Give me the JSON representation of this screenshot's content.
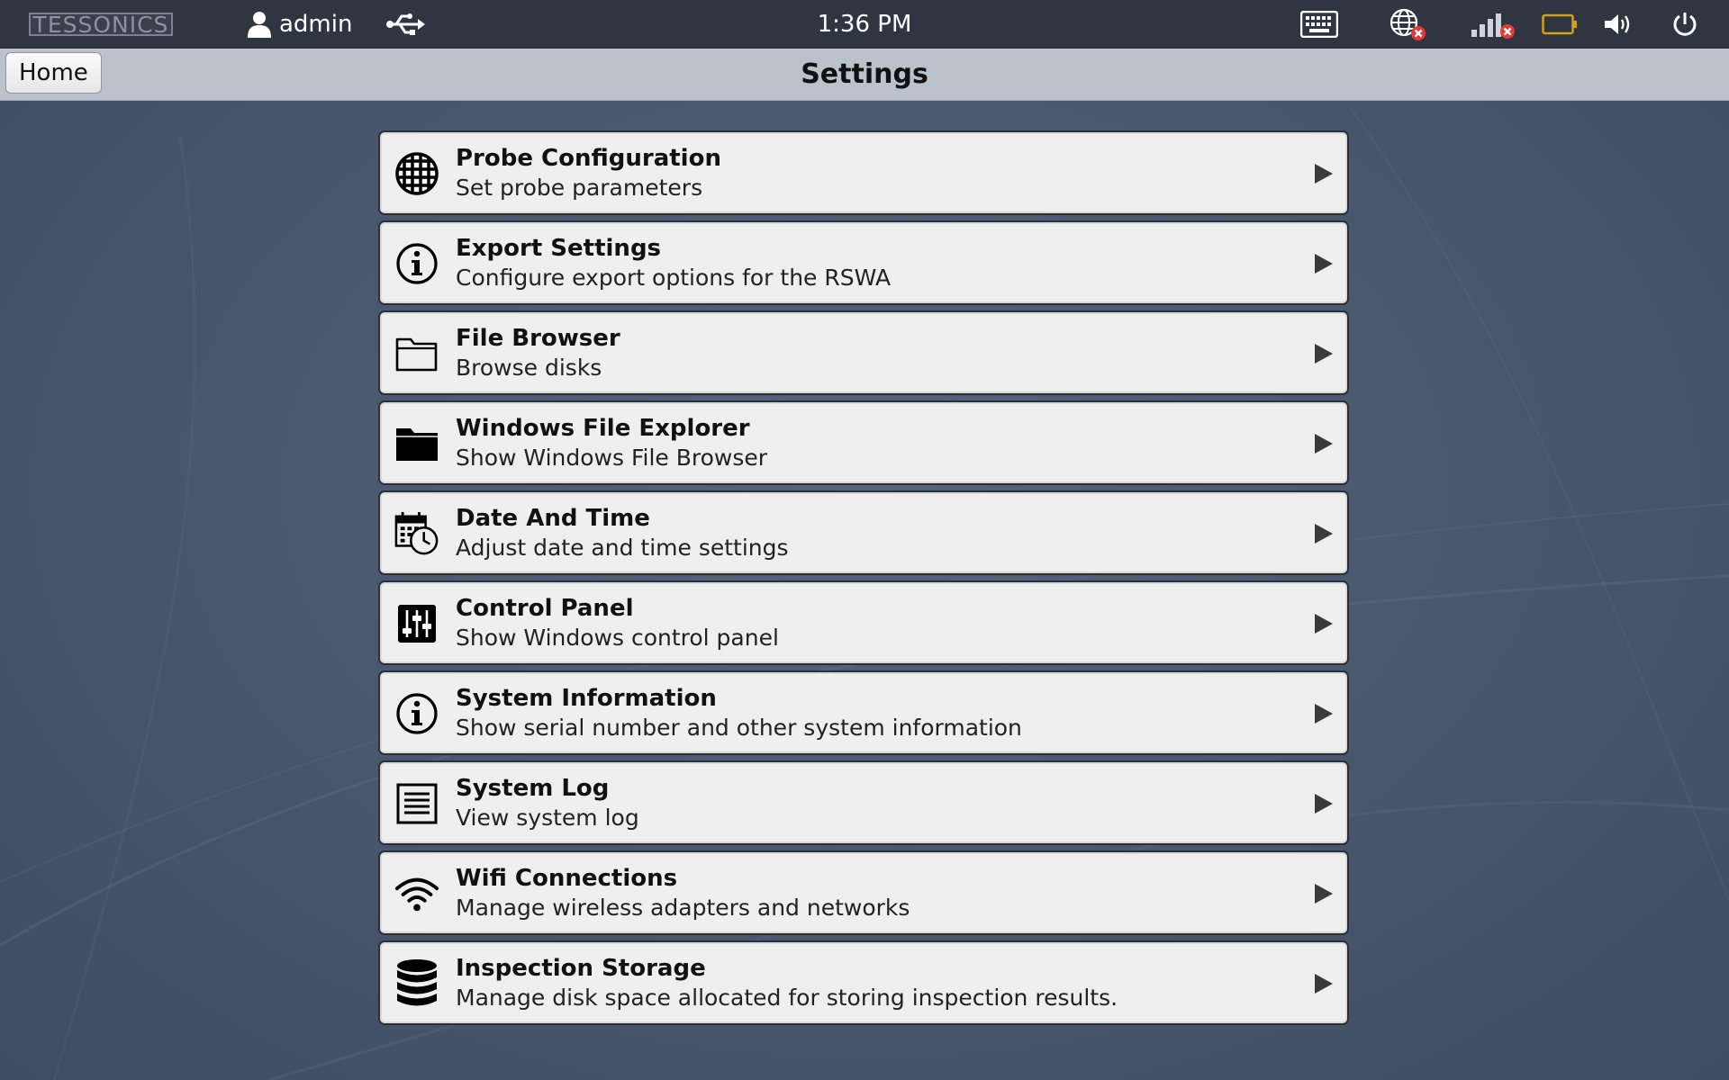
{
  "topbar": {
    "logo": "TESSONICS",
    "user": "admin",
    "time": "1:36 PM",
    "icons": [
      "user-icon",
      "usb-icon",
      "keyboard-icon",
      "globe-disconnected-icon",
      "signal-disconnected-icon",
      "battery-icon",
      "volume-icon",
      "power-icon"
    ]
  },
  "header": {
    "home_label": "Home",
    "title": "Settings"
  },
  "settings": [
    {
      "label": "Probe Configuration",
      "desc": "Set probe parameters",
      "icon": "probe-grid-icon"
    },
    {
      "label": "Export Settings",
      "desc": "Configure export options for the RSWA",
      "icon": "info-icon"
    },
    {
      "label": "File Browser",
      "desc": "Browse disks",
      "icon": "folder-outline-icon"
    },
    {
      "label": "Windows File Explorer",
      "desc": "Show Windows File Browser",
      "icon": "folder-filled-icon"
    },
    {
      "label": "Date And Time",
      "desc": "Adjust date and time settings",
      "icon": "calendar-clock-icon"
    },
    {
      "label": "Control Panel",
      "desc": "Show Windows control panel",
      "icon": "sliders-icon"
    },
    {
      "label": "System Information",
      "desc": "Show serial number and other system information",
      "icon": "info-icon"
    },
    {
      "label": "System Log",
      "desc": "View system log",
      "icon": "log-list-icon"
    },
    {
      "label": "Wifi Connections",
      "desc": "Manage wireless adapters and networks",
      "icon": "wifi-icon"
    },
    {
      "label": "Inspection Storage",
      "desc": "Manage disk space allocated for storing inspection results.",
      "icon": "database-icon"
    }
  ],
  "colors": {
    "topbar": "#2f3642",
    "header": "#bcc2cc",
    "row_bg": "#efefef",
    "status_error": "#e53935",
    "battery": "#d4a017"
  }
}
